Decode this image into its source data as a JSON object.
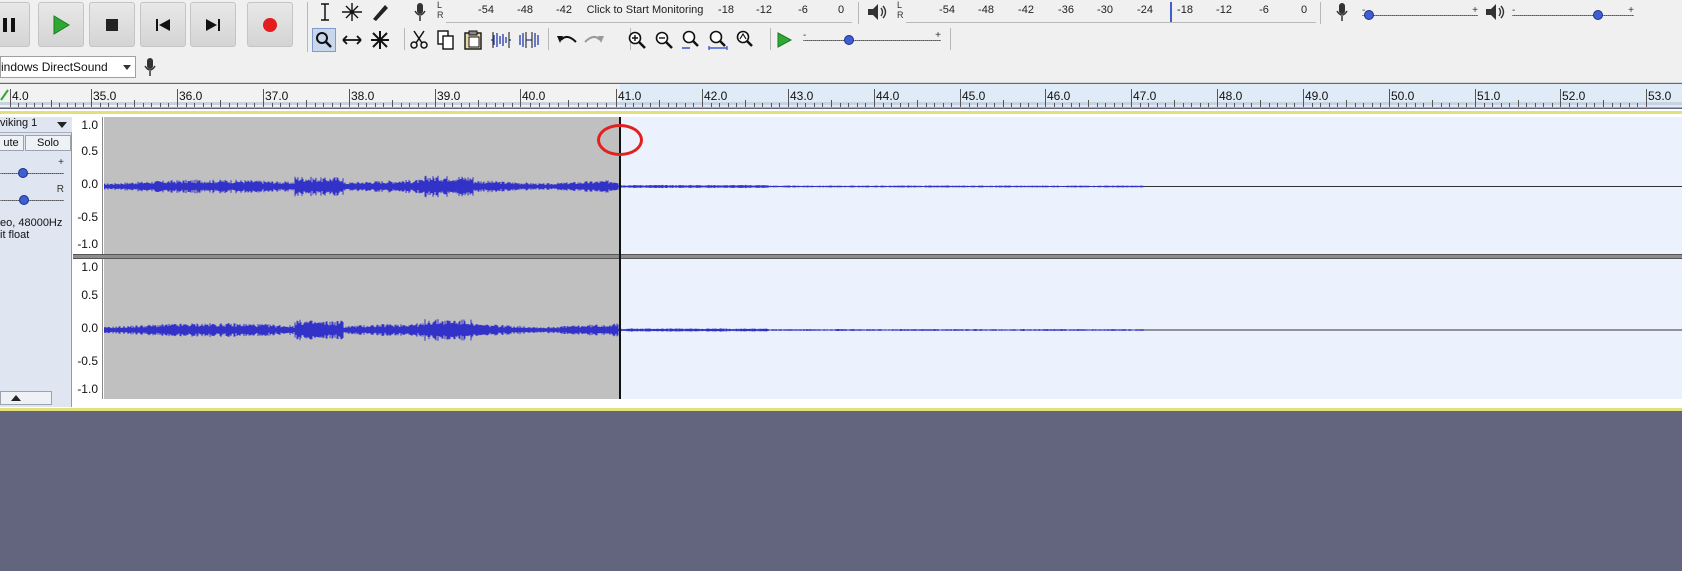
{
  "colors": {
    "accent": "#3f5fd1",
    "record": "#e31d1d",
    "play": "#2eaa34",
    "selection_bg": "#c0c0c0",
    "unselected_bg": "#ebf2fd",
    "waveform": "#3232c8",
    "empty_area": "#63657f",
    "highlight_circle": "#e32020"
  },
  "transport": {
    "icons": [
      "pause-icon",
      "play-icon",
      "stop-icon",
      "skip-start-icon",
      "skip-end-icon",
      "record-icon"
    ]
  },
  "tools": {
    "icons": [
      "selection-tool-icon",
      "envelope-tool-icon",
      "draw-tool-icon",
      "zoom-tool-icon",
      "time-shift-tool-icon",
      "multi-tool-icon"
    ]
  },
  "edit": {
    "icons": [
      "cut-icon",
      "copy-icon",
      "paste-icon",
      "trim-icon",
      "silence-icon",
      "undo-icon",
      "redo-icon",
      "zoom-in-icon",
      "zoom-out-icon",
      "fit-selection-icon",
      "fit-project-icon",
      "zoom-toggle-icon",
      "play-at-speed-icon"
    ]
  },
  "recording_meter": {
    "channels": [
      "L",
      "R"
    ],
    "ticks": [
      "-54",
      "-48",
      "-42",
      "-18",
      "-12",
      "-6",
      "0"
    ],
    "prompt": "Click to Start Monitoring"
  },
  "playback_meter": {
    "channels": [
      "L",
      "R"
    ],
    "ticks": [
      "-54",
      "-48",
      "-42",
      "-36",
      "-30",
      "-24",
      "-18",
      "-12",
      "-6",
      "0"
    ]
  },
  "mixer": {
    "recording_volume": 0.02,
    "playback_volume": 0.72,
    "plus": "+",
    "minus": "-"
  },
  "device": {
    "host": "indows DirectSound"
  },
  "ruler": {
    "labels": [
      "4.0",
      "35.0",
      "36.0",
      "37.0",
      "38.0",
      "39.0",
      "40.0",
      "41.0",
      "42.0",
      "43.0",
      "44.0",
      "45.0",
      "46.0",
      "47.0",
      "48.0",
      "49.0",
      "50.0",
      "51.0",
      "52.0",
      "53.0"
    ]
  },
  "track": {
    "name": "viking 1",
    "mute": "ute",
    "solo": "Solo",
    "gain_plus": "+",
    "pan_right": "R",
    "info_line1": "eo, 48000Hz",
    "info_line2": "it float",
    "amplitude_labels": [
      "1.0",
      "0.5",
      "0.0",
      "-0.5",
      "-1.0"
    ]
  }
}
